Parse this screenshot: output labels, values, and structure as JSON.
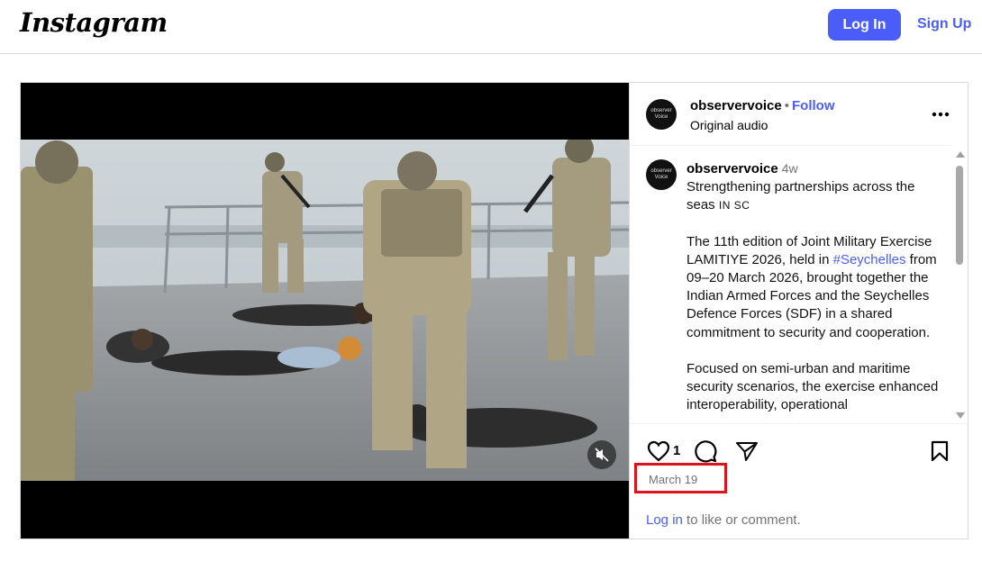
{
  "header": {
    "logo": "Instagram",
    "login_label": "Log In",
    "signup_label": "Sign Up",
    "brand_color": "#4a5df9"
  },
  "post": {
    "username": "observervoice",
    "dot": "•",
    "follow_label": "Follow",
    "audio_label": "Original audio",
    "avatar_text": "observer Voice",
    "more_icon": "more-horizontal-icon",
    "caption": {
      "username": "observervoice",
      "time": "4w",
      "line1": "Strengthening partnerships across the seas",
      "line1_suffix": "IN SC",
      "para2_before": "The 11th edition of Joint Military Exercise LAMITIYE 2026, held in",
      "hashtag": "#Seychelles",
      "para2_after": "from 09–20 March 2026, brought together the Indian Armed Forces and the Seychelles Defence Forces (SDF) in a shared commitment to security and cooperation.",
      "para3": "Focused on semi-urban and maritime security scenarios, the exercise enhanced interoperability, operational"
    },
    "likes": "1",
    "date": "March 19",
    "login_link": "Log in",
    "login_rest": " to like or comment.",
    "highlight_color": "#e0111b"
  }
}
